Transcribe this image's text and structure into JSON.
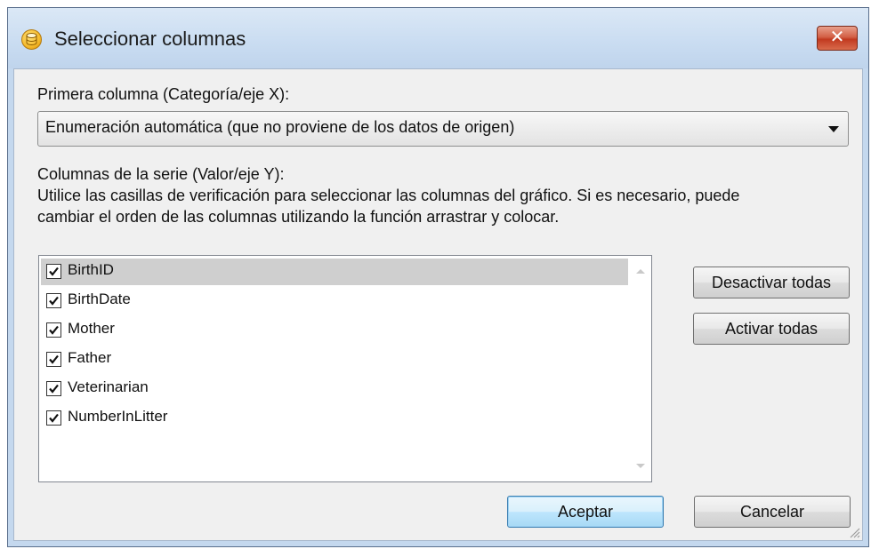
{
  "window": {
    "title": "Seleccionar columnas",
    "close_glyph": "✕",
    "icon": "database-icon"
  },
  "first_column": {
    "label": "Primera columna (Categoría/eje X):",
    "selected": "Enumeración automática (que no proviene de los datos de origen)"
  },
  "series": {
    "label": "Columnas de la serie (Valor/eje Y):",
    "help_line1": "Utilice las casillas de verificación para seleccionar las columnas del gráfico. Si es necesario, puede",
    "help_line2": "cambiar el orden de las columnas utilizando la función arrastrar y colocar.",
    "items": [
      {
        "label": "BirthID",
        "checked": true,
        "selected": true
      },
      {
        "label": "BirthDate",
        "checked": true,
        "selected": false
      },
      {
        "label": "Mother",
        "checked": true,
        "selected": false
      },
      {
        "label": "Father",
        "checked": true,
        "selected": false
      },
      {
        "label": "Veterinarian",
        "checked": true,
        "selected": false
      },
      {
        "label": "NumberInLitter",
        "checked": true,
        "selected": false
      }
    ]
  },
  "buttons": {
    "deactivate_all": "Desactivar todas",
    "activate_all": "Activar todas",
    "ok": "Aceptar",
    "cancel": "Cancelar"
  }
}
